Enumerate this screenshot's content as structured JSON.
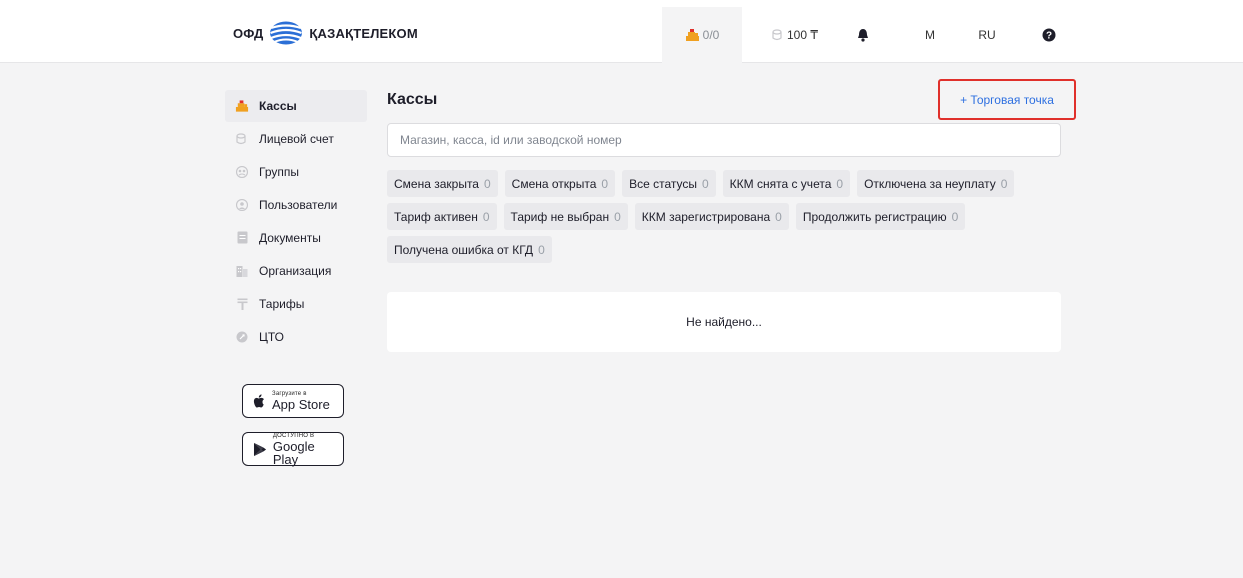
{
  "header": {
    "logo_left": "ОФД",
    "logo_right": "ҚАЗАҚТЕЛЕКОМ",
    "cash_count": "0/0",
    "balance": "100 ₸",
    "user_initial": "M",
    "language": "RU"
  },
  "sidebar": {
    "items": [
      {
        "label": "Кассы",
        "icon": "cash-register-icon"
      },
      {
        "label": "Лицевой счет",
        "icon": "coins-icon"
      },
      {
        "label": "Группы",
        "icon": "group-icon"
      },
      {
        "label": "Пользователи",
        "icon": "user-icon"
      },
      {
        "label": "Документы",
        "icon": "document-icon"
      },
      {
        "label": "Организация",
        "icon": "building-icon"
      },
      {
        "label": "Тарифы",
        "icon": "tariff-icon"
      },
      {
        "label": "ЦТО",
        "icon": "service-center-icon"
      }
    ],
    "appstore": {
      "small": "Загрузите в",
      "big": "App Store"
    },
    "googleplay": {
      "small": "ДОСТУПНО В",
      "big": "Google Play"
    }
  },
  "main": {
    "title": "Кассы",
    "add_button": "+ Торговая точка",
    "search_placeholder": "Магазин, касса, id или заводской номер",
    "filters": [
      {
        "label": "Смена закрыта",
        "count": "0"
      },
      {
        "label": "Смена открыта",
        "count": "0"
      },
      {
        "label": "Все статусы",
        "count": "0"
      },
      {
        "label": "ККМ снята с учета",
        "count": "0"
      },
      {
        "label": "Отключена за неуплату",
        "count": "0"
      },
      {
        "label": "Тариф активен",
        "count": "0"
      },
      {
        "label": "Тариф не выбран",
        "count": "0"
      },
      {
        "label": "ККМ зарегистрирована",
        "count": "0"
      },
      {
        "label": "Продолжить регистрацию",
        "count": "0"
      },
      {
        "label": "Получена ошибка от КГД",
        "count": "0"
      }
    ],
    "empty_text": "Не найдено..."
  },
  "colors": {
    "accent_orange": "#f0a020",
    "link_blue": "#2d6fe0",
    "highlight_red": "#e0302b",
    "background": "#f4f4f5"
  }
}
